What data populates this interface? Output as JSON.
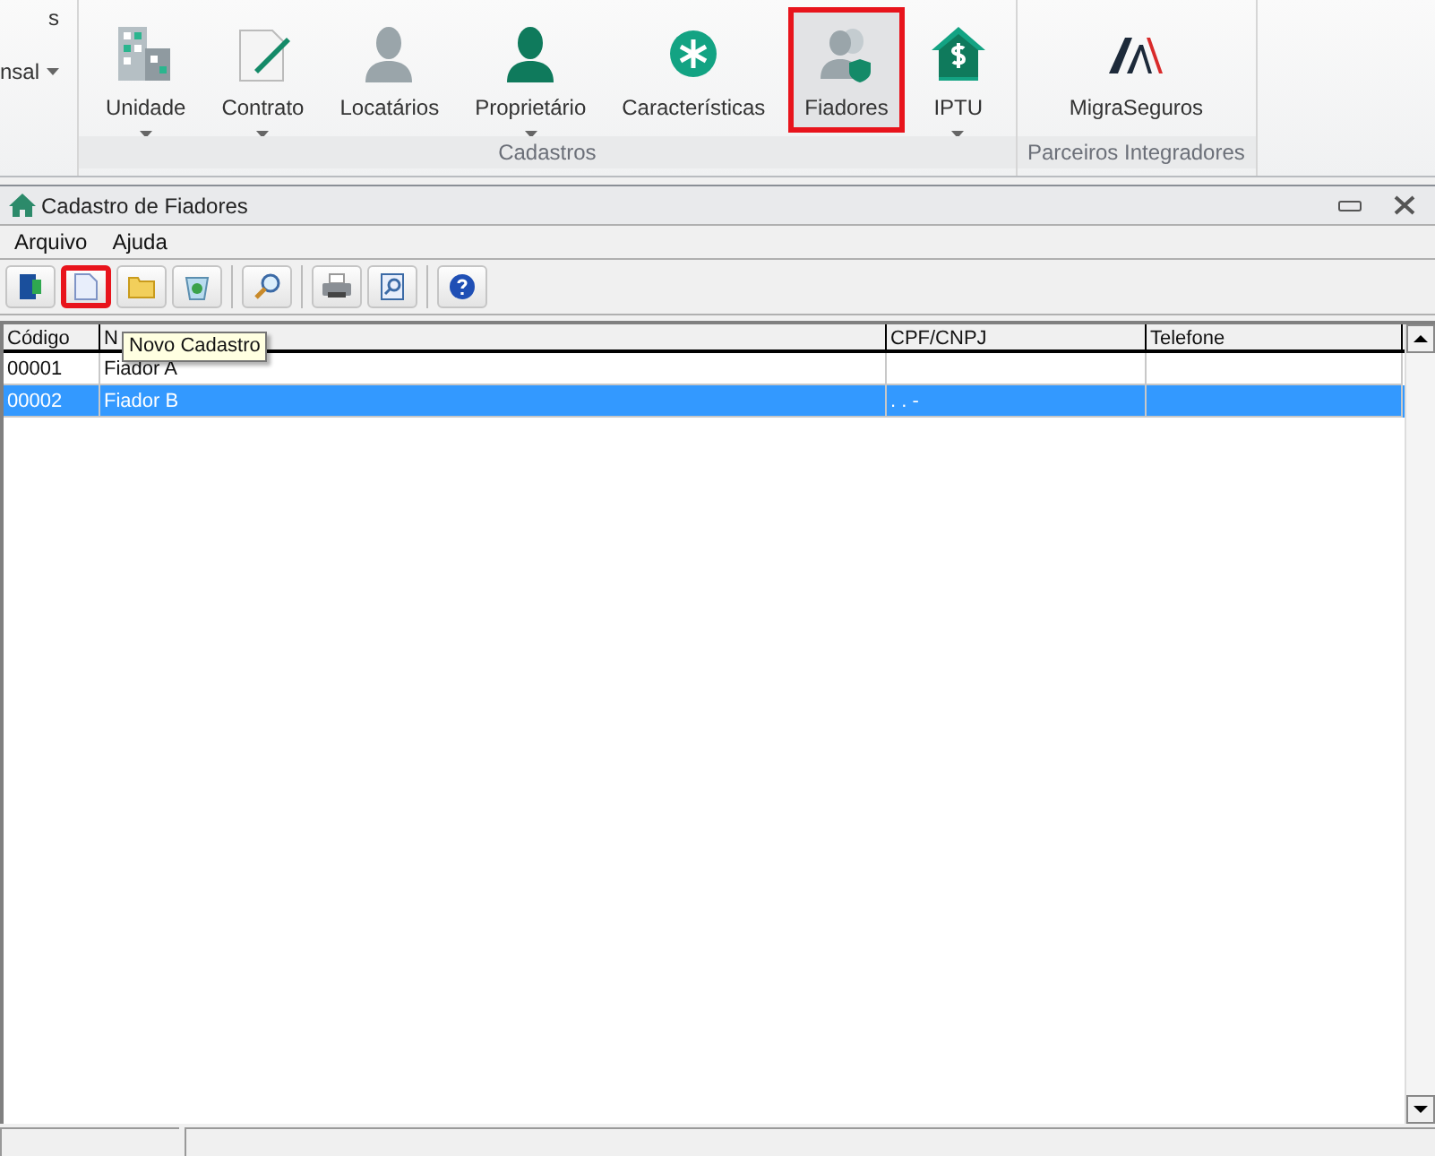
{
  "ribbon": {
    "cut_items": [
      {
        "label": "s",
        "caret": false
      },
      {
        "label": "nsal",
        "caret": true
      }
    ],
    "groups": [
      {
        "label": "Cadastros",
        "buttons": [
          {
            "label": "Unidade",
            "caret": true,
            "selected": false
          },
          {
            "label": "Contrato",
            "caret": true,
            "selected": false
          },
          {
            "label": "Locatários",
            "caret": false,
            "selected": false
          },
          {
            "label": "Proprietário",
            "caret": true,
            "selected": false
          },
          {
            "label": "Características",
            "caret": false,
            "selected": false
          },
          {
            "label": "Fiadores",
            "caret": false,
            "selected": true
          },
          {
            "label": "IPTU",
            "caret": true,
            "selected": false
          }
        ]
      },
      {
        "label": "Parceiros Integradores",
        "buttons": [
          {
            "label": "MigraSeguros",
            "caret": false,
            "selected": false
          }
        ]
      }
    ]
  },
  "window": {
    "title": "Cadastro de Fiadores"
  },
  "menu": [
    "Arquivo",
    "Ajuda"
  ],
  "toolbar": [
    [
      {
        "highlighted": false
      },
      {
        "highlighted": true
      },
      {
        "highlighted": false
      },
      {
        "highlighted": false
      }
    ],
    [
      {
        "highlighted": false
      }
    ],
    [
      {
        "highlighted": false
      },
      {
        "highlighted": false
      }
    ],
    [
      {
        "highlighted": false
      }
    ]
  ],
  "tooltip": "Novo Cadastro",
  "table": {
    "columns": [
      "Código",
      "N",
      "CPF/CNPJ",
      "Telefone"
    ],
    "rows": [
      {
        "cells": [
          "00001",
          "Fiador A",
          "",
          ""
        ],
        "selected": false
      },
      {
        "cells": [
          "00002",
          "Fiador B",
          ". . -",
          ""
        ],
        "selected": true
      }
    ]
  }
}
